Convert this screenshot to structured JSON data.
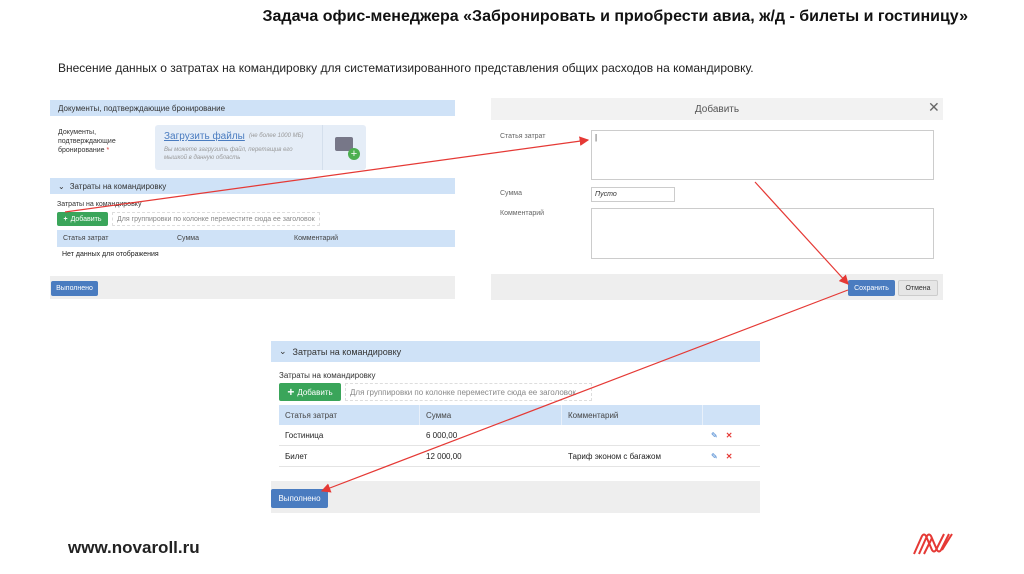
{
  "title": "Задача офис-менеджера «Забронировать и приобрести авиа, ж/д - билеты и гостиницу»",
  "subtitle": "Внесение данных о затратах на командировку для систематизированного представления общих расходов на командировку.",
  "panel1": {
    "docs_header": "Документы, подтверждающие бронирование",
    "docs_label": "Документы, подтверждающие бронирование",
    "required_mark": "*",
    "upload_link": "Загрузить файлы",
    "upload_limit": "(не более 1000 МБ)",
    "upload_hint": "Вы можете загрузить файл, перетащив его мышкой в данную область",
    "section_header": "Затраты на командировку",
    "grid_label": "Затраты на командировку",
    "add_label": "Добавить",
    "group_hint": "Для группировки по колонке переместите сюда ее заголовок",
    "columns": [
      "Статья затрат",
      "Сумма",
      "Комментарий"
    ],
    "empty": "Нет данных для отображения",
    "done_label": "Выполнено"
  },
  "dialog": {
    "title": "Добавить",
    "expense_label": "Статья затрат",
    "expense_value": "|",
    "sum_label": "Сумма",
    "sum_placeholder": "Пусто",
    "comment_label": "Комментарий",
    "save_label": "Сохранить",
    "cancel_label": "Отмена"
  },
  "panel3": {
    "section_header": "Затраты на командировку",
    "grid_label": "Затраты на командировку",
    "add_label": "Добавить",
    "group_hint": "Для группировки по колонке переместите сюда ее заголовок",
    "columns": [
      "Статья затрат",
      "Сумма",
      "Комментарий"
    ],
    "rows": [
      {
        "item": "Гостиница",
        "sum": "6 000,00",
        "comment": ""
      },
      {
        "item": "Билет",
        "sum": "12 000,00",
        "comment": "Тариф эконом с багажом"
      }
    ],
    "done_label": "Выполнено"
  },
  "footer": {
    "url": "www.novaroll.ru"
  },
  "colors": {
    "accent": "#4a7cc0",
    "add": "#3aa55a",
    "arrow": "#e53935",
    "header": "#cfe2f7"
  }
}
